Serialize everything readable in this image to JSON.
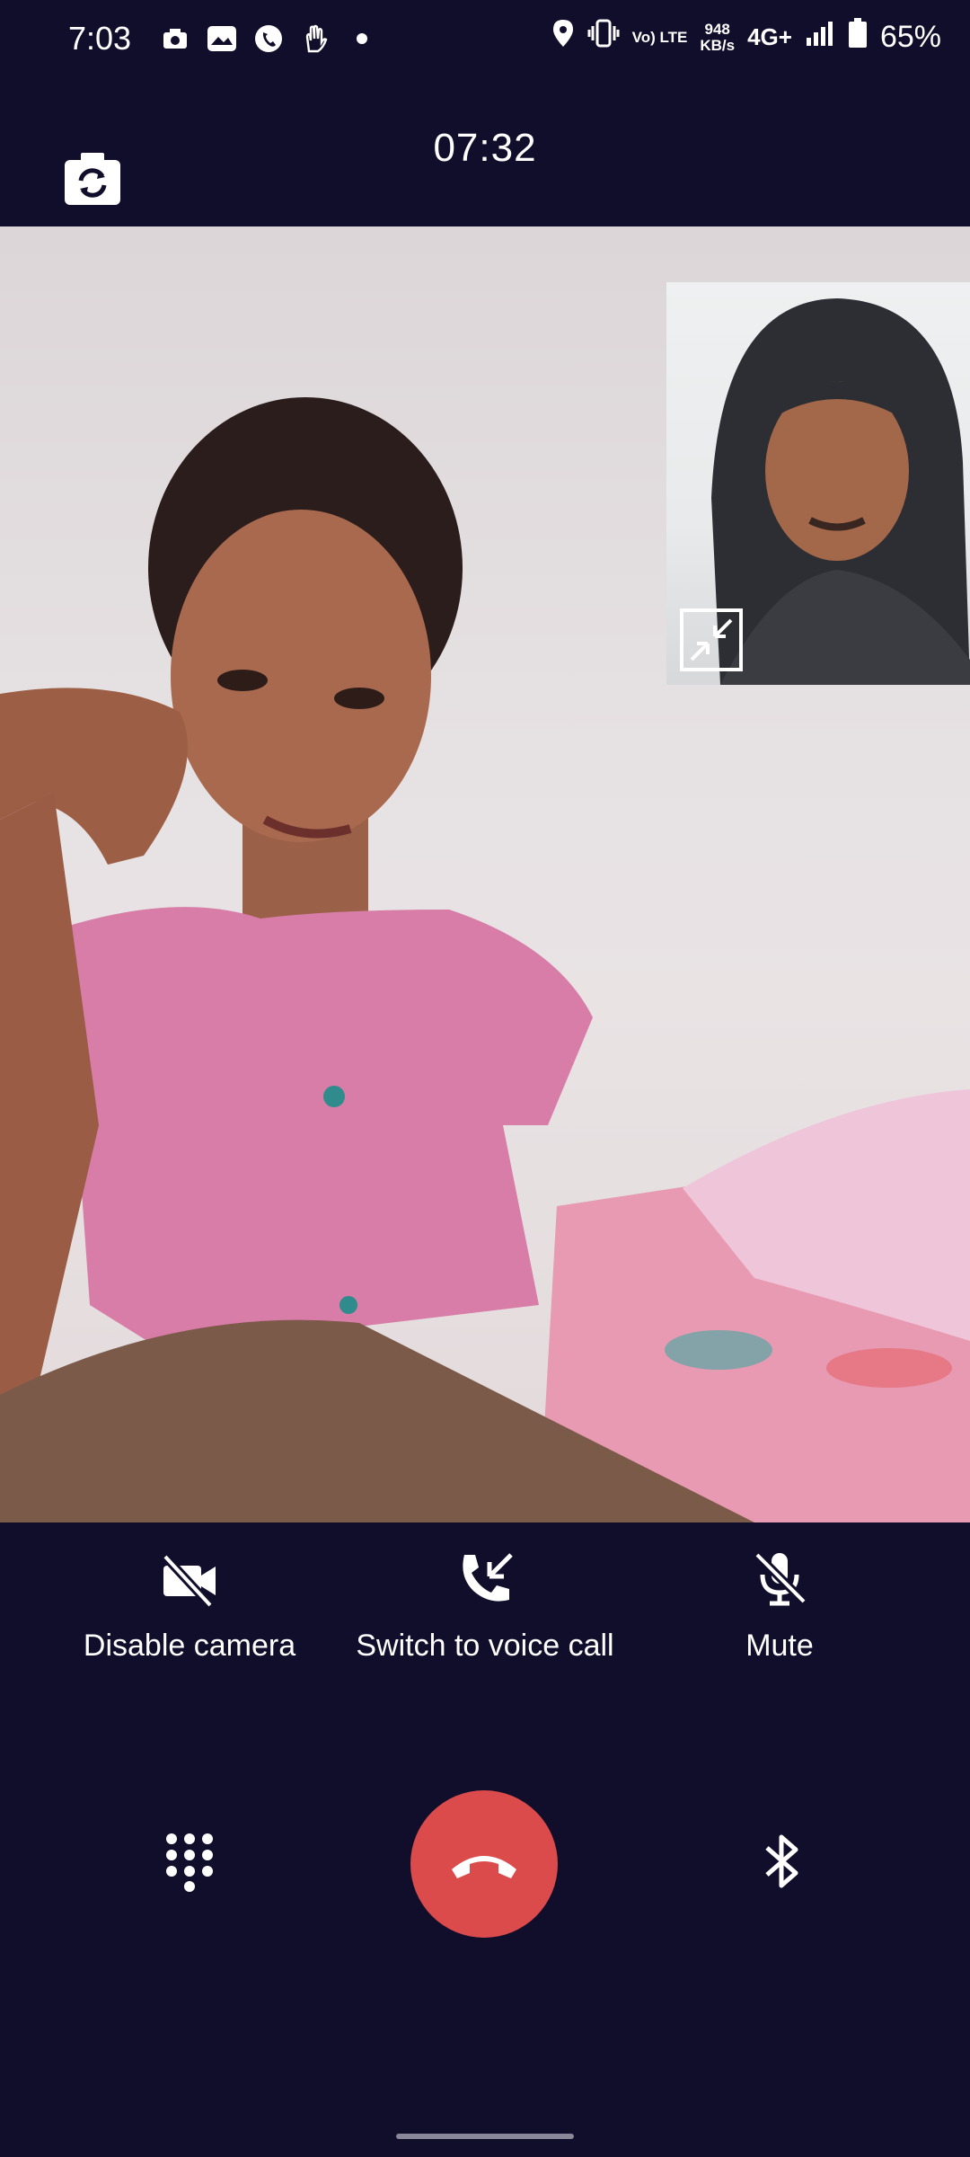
{
  "status_bar": {
    "time": "7:03",
    "net_speed_value": "948",
    "net_speed_unit": "KB/s",
    "volte": "Vo) LTE",
    "network": "4G+",
    "battery": "65%",
    "icons": [
      "camera-app-icon",
      "gallery-notification-icon",
      "phone-notification-icon",
      "gesture-icon",
      "dot-icon",
      "location-icon",
      "vibrate-icon",
      "signal-icon",
      "battery-icon"
    ]
  },
  "call": {
    "timer": "07:32"
  },
  "controls": {
    "disable_camera": "Disable camera",
    "switch_voice": "Switch to voice call",
    "mute": "Mute"
  },
  "colors": {
    "background": "#110e2c",
    "end_call": "#dc4b4b"
  }
}
